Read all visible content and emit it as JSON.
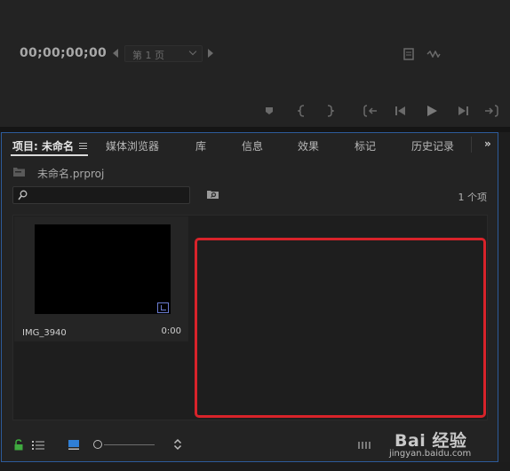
{
  "monitor": {
    "timecode": "00;00;00;00",
    "page_select": "第 1 页"
  },
  "project_panel": {
    "tabs": [
      {
        "label": "项目: 未命名",
        "active": true
      },
      {
        "label": "媒体浏览器"
      },
      {
        "label": "库"
      },
      {
        "label": "信息"
      },
      {
        "label": "效果"
      },
      {
        "label": "标记"
      },
      {
        "label": "历史记录"
      }
    ],
    "more_tabs": "»",
    "project_file": "未命名.prproj",
    "search": {
      "value": "",
      "placeholder": ""
    },
    "item_count": "1 个项",
    "clip": {
      "name": "IMG_3940",
      "duration": "0:00"
    }
  },
  "watermark": {
    "brand": "Bai 经验",
    "url": "jingyan.baidu.com"
  },
  "colors": {
    "panel_focus": "#2d5b9b",
    "highlight": "#d8232a",
    "bg": "#232323"
  }
}
